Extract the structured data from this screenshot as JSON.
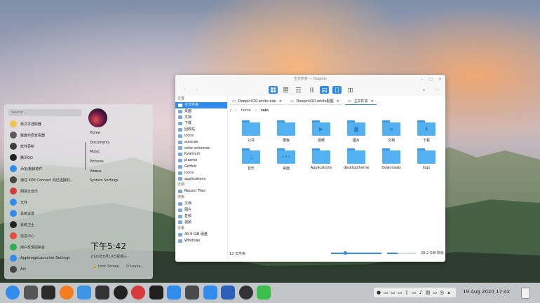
{
  "launcher": {
    "search_placeholder": "Search ...",
    "apps": [
      {
        "label": "核文字选取器",
        "color": "#f1c44d"
      },
      {
        "label": "键盘布局查看器",
        "color": "#5a5a5a"
      },
      {
        "label": "软件更新",
        "color": "#3b3b3b"
      },
      {
        "label": "腾讯QQ",
        "color": "#222222"
      },
      {
        "label": "添加/删除软件",
        "color": "#2f8ced"
      },
      {
        "label": "通过 KDE Connect 向已连接的...",
        "color": "#444444"
      },
      {
        "label": "网易云音乐",
        "color": "#d83b3b"
      },
      {
        "label": "文件",
        "color": "#2f8ced"
      },
      {
        "label": "系统设置",
        "color": "#2f8ced"
      },
      {
        "label": "系统卫士",
        "color": "#222222"
      },
      {
        "label": "信息中心",
        "color": "#e64b3b"
      },
      {
        "label": "用户反馈控制台",
        "color": "#2fae4f"
      },
      {
        "label": "AppImageLauncher Settings",
        "color": "#2f8ced"
      },
      {
        "label": "Ark",
        "color": "#444444"
      }
    ],
    "places": [
      "Home",
      "Documents",
      "Music",
      "Pictures",
      "Videos",
      "System Settings"
    ],
    "clock": "下午5:42",
    "date": "2020年8月19日星期三",
    "lock_screen": "Lock Screen",
    "leave": "Leave..."
  },
  "dolphin": {
    "title": "主文件夹 — Dolphin",
    "sidebar": {
      "places_header": "位置",
      "places": [
        {
          "label": "主文件夹",
          "selected": true
        },
        {
          "label": "桌面"
        },
        {
          "label": "文档"
        },
        {
          "label": "下载"
        },
        {
          "label": "回收站"
        },
        {
          "label": "icons"
        },
        {
          "label": "aurorae"
        },
        {
          "label": "color-schemes"
        },
        {
          "label": "Kvantum"
        },
        {
          "label": "plasma"
        },
        {
          "label": "GitHub"
        },
        {
          "label": "icons"
        },
        {
          "label": "applications"
        }
      ],
      "recent_header": "近期",
      "recent": [
        "Recent Files"
      ],
      "search_header": "搜索",
      "search": [
        "文档",
        "图片",
        "音频",
        "视频"
      ],
      "devices_header": "设备",
      "devices": [
        "40.9 GiB 硬盘",
        "Windows"
      ]
    },
    "tabs": [
      {
        "label": "DeepinV20-white-kde",
        "active": false
      },
      {
        "label": "DeepinV20-white配图",
        "active": false
      },
      {
        "label": "主文件夹",
        "active": true
      }
    ],
    "breadcrumb": [
      "/",
      "home",
      "rain"
    ],
    "files": [
      {
        "name": "公共",
        "glyph": ""
      },
      {
        "name": "模板",
        "glyph": ""
      },
      {
        "name": "视频",
        "glyph": "▶"
      },
      {
        "name": "图片",
        "glyph": "◙"
      },
      {
        "name": "文档",
        "glyph": "≡"
      },
      {
        "name": "下载",
        "glyph": "⬇"
      },
      {
        "name": "音乐",
        "glyph": "♫"
      },
      {
        "name": "桌面",
        "glyph": "•••"
      },
      {
        "name": "Applications",
        "glyph": ""
      },
      {
        "name": "desktoptheme",
        "glyph": ""
      },
      {
        "name": "Downloads",
        "glyph": ""
      },
      {
        "name": "logs",
        "glyph": ""
      }
    ],
    "status": "12 文件夹",
    "free_space": "28.2 GiB 剩余",
    "free_fraction": 0.36,
    "zoom_fraction": 0.28
  },
  "dock": {
    "datetime": "19 Aug 2020 17:42",
    "apps": [
      {
        "name": "launcher-icon",
        "color": "#2f8ced"
      },
      {
        "name": "system-monitor-icon",
        "color": "#555555"
      },
      {
        "name": "terminal-icon",
        "color": "#2b2b2b"
      },
      {
        "name": "firefox-icon",
        "color": "#f57c1f"
      },
      {
        "name": "file-manager-icon",
        "color": "#3e95e6"
      },
      {
        "name": "inkscape-icon",
        "color": "#333333"
      },
      {
        "name": "chrome-icon",
        "color": "#222222"
      },
      {
        "name": "netease-music-icon",
        "color": "#d83b3b"
      },
      {
        "name": "github-icon",
        "color": "#1f1f1f"
      },
      {
        "name": "music-icon",
        "color": "#2f8ced"
      },
      {
        "name": "calculator-icon",
        "color": "#4a4a4a"
      },
      {
        "name": "app-store-icon",
        "color": "#2f8ced"
      },
      {
        "name": "wps-writer-icon",
        "color": "#2c5fb5"
      },
      {
        "name": "deepin-guard-icon",
        "color": "#333333"
      },
      {
        "name": "wechat-icon",
        "color": "#3cbf4c"
      }
    ]
  }
}
